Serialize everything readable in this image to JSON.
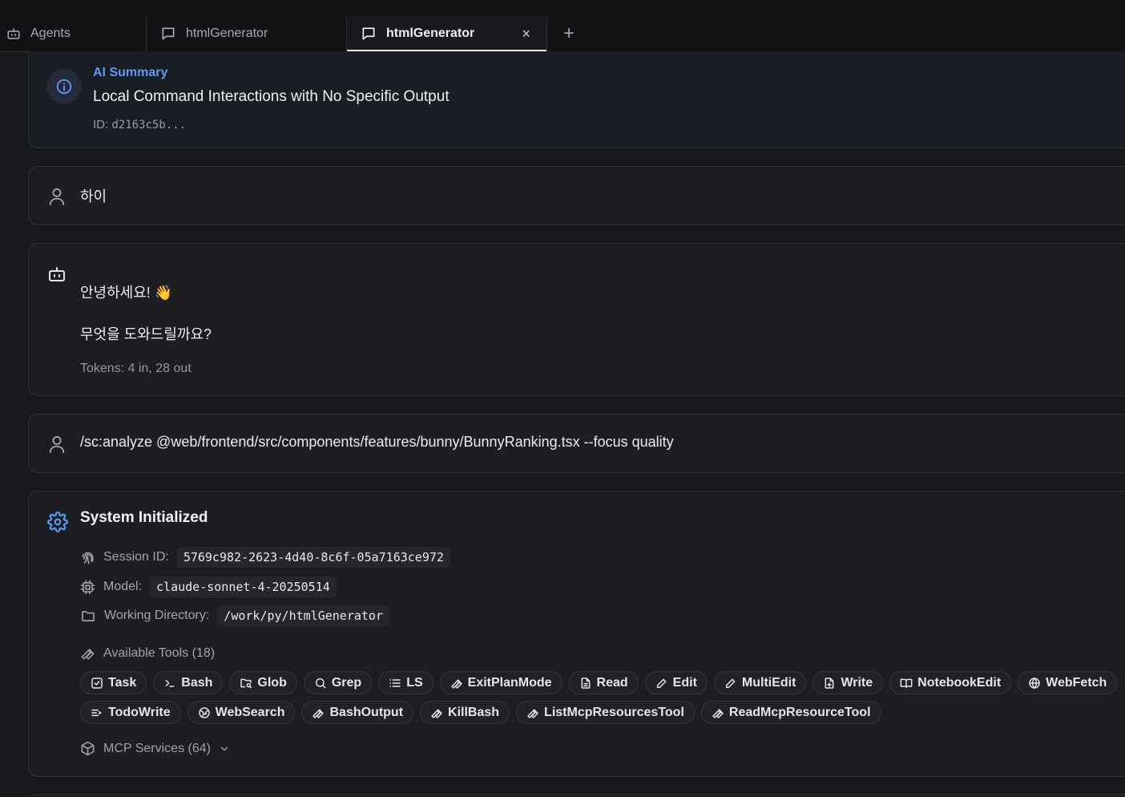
{
  "tabs": [
    {
      "label": "Agents",
      "icon": "bot-icon",
      "active": false
    },
    {
      "label": "htmlGenerator",
      "icon": "chat-bubble-icon",
      "active": false
    },
    {
      "label": "htmlGenerator",
      "icon": "chat-bubble-icon",
      "active": true,
      "close": "×"
    }
  ],
  "tab_add": "+",
  "summary": {
    "label": "AI Summary",
    "title": "Local Command Interactions with No Specific Output",
    "id_label": "ID:",
    "id_value": "d2163c5b..."
  },
  "messages": {
    "user1": "하이",
    "bot_line1": "안녕하세요! 👋",
    "bot_line2": "무엇을 도와드릴까요?",
    "bot_tokens": "Tokens: 4 in, 28 out",
    "user2": "/sc:analyze @web/frontend/src/components/features/bunny/BunnyRanking.tsx --focus quality"
  },
  "system": {
    "title": "System Initialized",
    "session_label": "Session ID:",
    "session_value": "5769c982-2623-4d40-8c6f-05a7163ce972",
    "model_label": "Model:",
    "model_value": "claude-sonnet-4-20250514",
    "wd_label": "Working Directory:",
    "wd_value": "/work/py/htmlGenerator",
    "tools_label": "Available Tools (18)",
    "tools_row1": [
      {
        "label": "Task",
        "icon": "checkbox-icon"
      },
      {
        "label": "Bash",
        "icon": "terminal-icon"
      },
      {
        "label": "Glob",
        "icon": "folder-search-icon"
      },
      {
        "label": "Grep",
        "icon": "search-icon"
      },
      {
        "label": "LS",
        "icon": "list-icon"
      },
      {
        "label": "ExitPlanMode",
        "icon": "wrench-icon"
      },
      {
        "label": "Read",
        "icon": "file-text-icon"
      },
      {
        "label": "Edit",
        "icon": "pencil-icon"
      },
      {
        "label": "MultiEdit",
        "icon": "pencil-icon"
      },
      {
        "label": "Write",
        "icon": "file-plus-icon"
      },
      {
        "label": "NotebookEdit",
        "icon": "book-icon"
      },
      {
        "label": "WebFetch",
        "icon": "globe-icon"
      }
    ],
    "tools_row2": [
      {
        "label": "TodoWrite",
        "icon": "list-todo-icon"
      },
      {
        "label": "WebSearch",
        "icon": "globe-search-icon"
      },
      {
        "label": "BashOutput",
        "icon": "wrench-icon"
      },
      {
        "label": "KillBash",
        "icon": "wrench-icon"
      },
      {
        "label": "ListMcpResourcesTool",
        "icon": "wrench-icon"
      },
      {
        "label": "ReadMcpResourceTool",
        "icon": "wrench-icon"
      }
    ],
    "mcp_label": "MCP Services (64)"
  },
  "colors": {
    "accent": "#5b9bf3",
    "background": "#18191c",
    "card": "#1d1e21"
  }
}
